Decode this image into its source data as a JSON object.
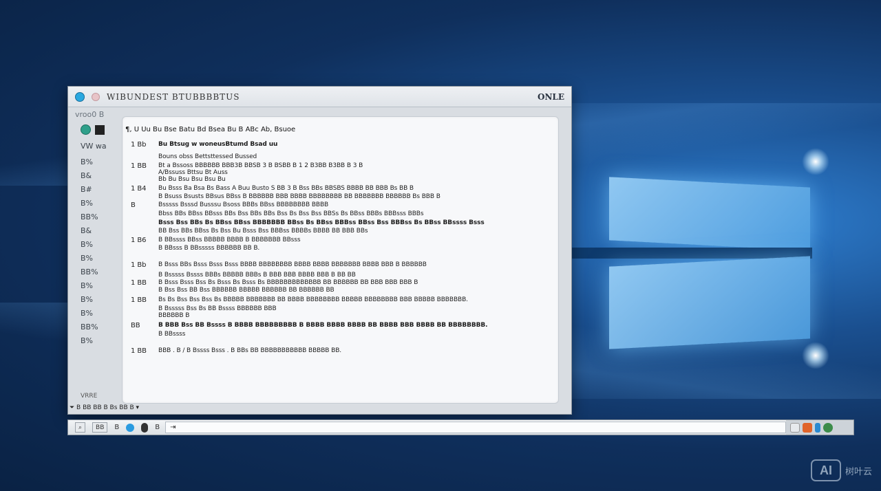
{
  "window": {
    "title": "WIBUNDEST   BTUBBBBTUS",
    "title_right": "ONLE",
    "toolbar_text": "vroo0  B"
  },
  "sidebar": {
    "top_label": "VW  wa",
    "items": [
      "B%",
      "B&",
      "B#",
      "B%",
      "BB%",
      "B&",
      "B%",
      "B%",
      "BB%",
      "B%",
      "B%",
      "B%",
      "BB%",
      "B%"
    ],
    "footer": "VRRE"
  },
  "document": {
    "header": "¶, U Uu Bu Bse Batu Bd Bsea Bu B ABc Ab, Bsuoe",
    "lines": [
      {
        "num": "1 Bb",
        "text": "Bu  Btsug  w woneusBtumd  Bsad  uu",
        "bold": true
      },
      {
        "num": "",
        "text": "Bouns obss Bettsttessed Bussed",
        "bold": false
      },
      {
        "num": "1 BB",
        "text": "Bt a Bssoss BBBBBB BBB3B BBSB 3 B BSBB B 1 2 B3BB B3BB B 3 B",
        "bold": false
      },
      {
        "num": "",
        "text": "A/Bssuss Bttsu Bt Auss",
        "bold": false
      },
      {
        "num": "",
        "text": "Bb  Bu  Bsu  Bsu  Bsu  Bu",
        "bold": false
      },
      {
        "num": "1 B4",
        "text": "Bu Bsss Ba Bsa Bs Bass A Buu Busto S BB 3 B Bss BBs BBSBS BBBB BB BBB Bs BB B",
        "bold": false
      },
      {
        "num": "",
        "text": "B Bsuss Bsusts BBsus BBss B BBBBBB BBB BBBB BBBBBBBB BB BBBBBBB BBBBBB Bs BBB B",
        "bold": false
      },
      {
        "num": "B",
        "text": "Bsssss Bsssd Busssu Bsoss BBBs BBss BBBBBBBB BBBB",
        "bold": false
      },
      {
        "num": "",
        "text": "Bbss BBs BBss BBsss BBs Bss BBs BBs Bss Bs Bss Bss BBSs Bs BBss BBBs BBBsss BBBs",
        "bold": false
      },
      {
        "num": "",
        "text": "Bsss Bss BBs Bs BBss BBss BBBBBBB BBss Bs BBss BBBss BBss Bss BBBss Bs BBss BBssss Bsss",
        "bold": true
      },
      {
        "num": "",
        "text": "BB Bss BBs BBss Bs Bss Bu Bsss Bss BBBss BBBBs BBBB BB BBB BBs",
        "bold": false
      },
      {
        "num": "1 B6",
        "text": "B BBssss BBss BBBBB BBBB B  BBBBBBB BBsss",
        "bold": false
      },
      {
        "num": "",
        "text": "B BBsss B BBsssss BBBBBB BB B.",
        "bold": false
      },
      {
        "num": "1 Bb",
        "text": "B Bsss BBs Bsss Bsss Bsss BBBB BBBBBBBB BBBB BBBB BBBBBBB BBBB BBB B BBBBBB",
        "bold": false
      },
      {
        "num": "",
        "text": "B Bsssss Bssss BBBs BBBBB BBBs B BBB BBB BBBB BBB B BB BB",
        "bold": false
      },
      {
        "num": "1 BB",
        "text": "B Bsss Bsss         Bss Bs Bsss Bs Bsss Bs BBBBBBBBBBBBB BB   BBBBBB BB BBB BBB BBB B",
        "bold": false
      },
      {
        "num": "",
        "text": "B Bss Bss BB Bss BBBBBB BBBBB                                 BBBBBB BB BBBBBB BB",
        "bold": false
      },
      {
        "num": "1 BB",
        "text": "Bs Bs Bss Bss Bss Bs BBBBB BBBBBBB BB BBBB BBBBBBBB BBBBB BBBBBBBB BBB BBBBB BBBBBBB.",
        "bold": false
      },
      {
        "num": "",
        "text": "B Bsssss Bss Bs BB Bssss   BBBBBB BBB",
        "bold": false
      },
      {
        "num": "",
        "text": "BBBBBB B",
        "bold": false
      },
      {
        "num": "BB",
        "text": "B BBB Bss BB Bssss B  BBBB BBBBBBBBB B BBBB BBBB BBBB BB BBBB BBB BBBB BB BBBBBBBB.",
        "bold": true
      },
      {
        "num": "",
        "text": "B BBssss",
        "bold": false
      },
      {
        "num": "1 BB",
        "text": "BBB . B / B Bssss Bsss . B BBs BB BBBBBBBBBBB BBBBB BB.",
        "bold": false
      }
    ]
  },
  "bottom_line": "⏷ B BB BB  B  Bs BB B ▾",
  "taskbar": {
    "box1": "⌕",
    "box2": "BB",
    "item1": "B",
    "item2": "B",
    "search_text": "⇥"
  },
  "watermark": {
    "box_text": "AI",
    "text": "树叶云"
  }
}
